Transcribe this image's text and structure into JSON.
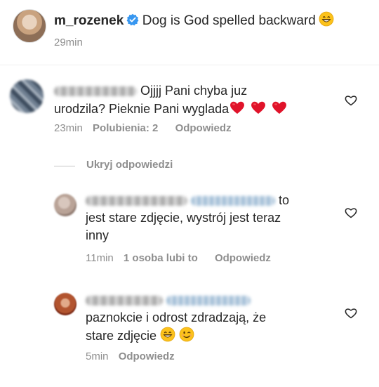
{
  "post": {
    "username": "m_rozenek",
    "caption": "Dog is God spelled backward",
    "time": "29min"
  },
  "comments": [
    {
      "text_line1": "Ojjjj Pani chyba juz",
      "text_line2": "urodzila? Pieknie Pani wyglada",
      "time": "23min",
      "likes": "Polubienia: 2",
      "reply": "Odpowiedz"
    }
  ],
  "hide_replies": "Ukryj odpowiedzi",
  "replies": [
    {
      "text_line0": "to",
      "text_line1": "jest stare zdjęcie, wystrój  jest teraz",
      "text_line2": "inny",
      "time": "11min",
      "likes": "1 osoba lubi to",
      "reply": "Odpowiedz"
    },
    {
      "text_line1": "paznokcie i odrost zdradzają, że",
      "text_line2": "stare zdjęcie",
      "time": "5min",
      "reply": "Odpowiedz"
    }
  ],
  "colors": {
    "verified": "#3897f0",
    "heart_red": "#e0132a",
    "meta_gray": "#8e8e8e"
  },
  "icons": [
    "verified-badge-icon",
    "grinning-emoji-icon",
    "red-heart-emoji-icon",
    "winking-emoji-icon",
    "like-heart-outline-icon"
  ]
}
